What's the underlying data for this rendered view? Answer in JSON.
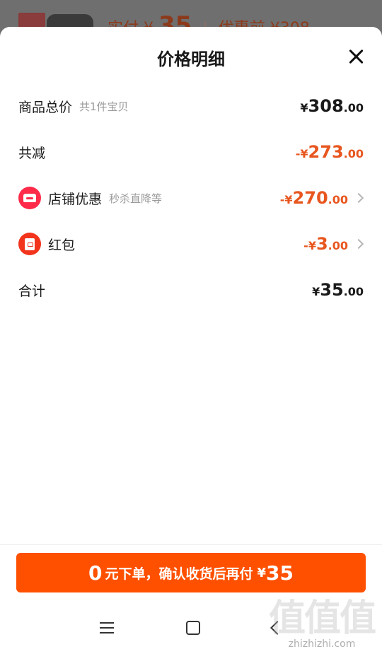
{
  "background": {
    "prefix": "实付",
    "currency": "¥",
    "amount": "35",
    "divider": "|",
    "original_label": "优惠前",
    "original_amount": "¥308"
  },
  "sheet": {
    "title": "价格明细"
  },
  "rows": {
    "total": {
      "label": "商品总价",
      "sub": "共1件宝贝",
      "currency": "¥",
      "int": "308",
      "dec": ".00"
    },
    "reduction": {
      "label": "共减",
      "prefix": "-",
      "currency": "¥",
      "int": "273",
      "dec": ".00"
    },
    "store": {
      "label": "店铺优惠",
      "sub": "秒杀直降等",
      "prefix": "-",
      "currency": "¥",
      "int": "270",
      "dec": ".00",
      "icon": "store-icon"
    },
    "hongbao": {
      "label": "红包",
      "prefix": "-",
      "currency": "¥",
      "int": "3",
      "dec": ".00",
      "icon": "red-envelope-icon"
    },
    "sum": {
      "label": "合计",
      "currency": "¥",
      "int": "35",
      "dec": ".00"
    }
  },
  "cta": {
    "zero": "0",
    "text": "元下单，确认收货后再付",
    "currency": "¥",
    "price": "35"
  },
  "watermark": {
    "big": "值值值",
    "small": "zhizhizhi.com"
  },
  "colors": {
    "accent": "#ff5000",
    "discount": "#e8561f",
    "store_icon": "#ff2a4a",
    "hongbao_icon": "#f2341d"
  }
}
